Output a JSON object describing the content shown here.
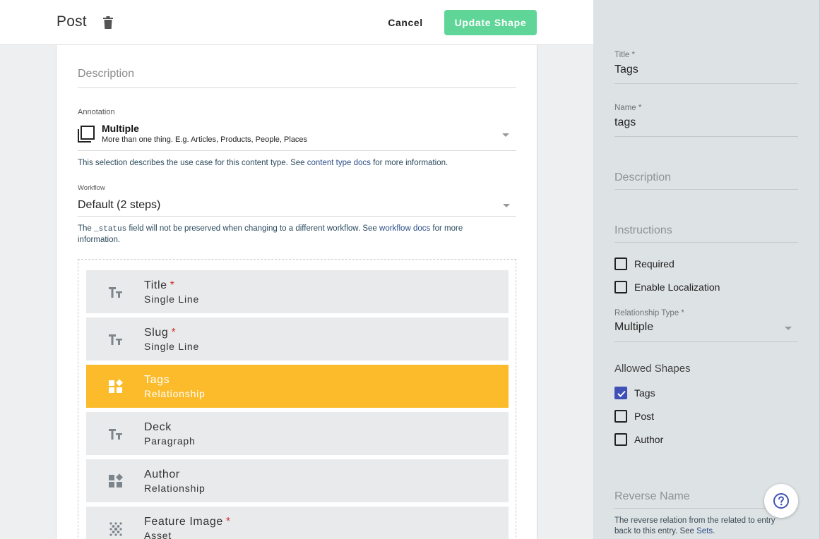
{
  "header": {
    "title": "Post",
    "cancel_label": "Cancel",
    "update_label": "Update Shape"
  },
  "main": {
    "description_placeholder": "Description",
    "annotation": {
      "label": "Annotation",
      "title": "Multiple",
      "subtitle": "More than one thing. E.g. Articles, Products, People, Places"
    },
    "annotation_help": {
      "pre": "This selection describes the use case for this content type. See ",
      "link": "content type docs",
      "post": " for more information."
    },
    "workflow": {
      "label": "Workflow",
      "value": "Default (2 steps)"
    },
    "workflow_help": {
      "pre": "The ",
      "code": "_status",
      "mid": " field will not be preserved when changing to a different workflow. See ",
      "link": "workflow docs",
      "post": " for more information."
    },
    "fields": [
      {
        "name": "Title",
        "type": "Single Line",
        "required": "*",
        "icon": "text-format-icon"
      },
      {
        "name": "Slug",
        "type": "Single Line",
        "required": "*",
        "icon": "text-format-icon"
      },
      {
        "name": "Tags",
        "type": "Relationship",
        "required": "",
        "icon": "widgets-icon",
        "active": true
      },
      {
        "name": "Deck",
        "type": "Paragraph",
        "required": "",
        "icon": "text-format-icon"
      },
      {
        "name": "Author",
        "type": "Relationship",
        "required": "",
        "icon": "widgets-icon"
      },
      {
        "name": "Feature Image",
        "type": "Asset",
        "required": "*",
        "icon": "asset-dots-icon"
      }
    ]
  },
  "panel": {
    "title_label": "Title *",
    "title_value": "Tags",
    "name_label": "Name *",
    "name_value": "tags",
    "description_placeholder": "Description",
    "instructions_placeholder": "Instructions",
    "required_label": "Required",
    "localization_label": "Enable Localization",
    "relationship_type_label": "Relationship Type *",
    "relationship_type_value": "Multiple",
    "allowed_shapes_heading": "Allowed Shapes",
    "allowed_shapes": [
      {
        "label": "Tags",
        "checked": true
      },
      {
        "label": "Post",
        "checked": false
      },
      {
        "label": "Author",
        "checked": false
      }
    ],
    "reverse_name_placeholder": "Reverse Name",
    "reverse_help": {
      "pre": "The reverse relation from the related to entry back to this entry. See ",
      "link": "Sets",
      "post": "."
    }
  },
  "colors": {
    "accent_green": "#5fd698",
    "active_row": "#fbbb2b",
    "checkbox_blue": "#3f51b5",
    "panel_bg": "#dde2e4"
  }
}
